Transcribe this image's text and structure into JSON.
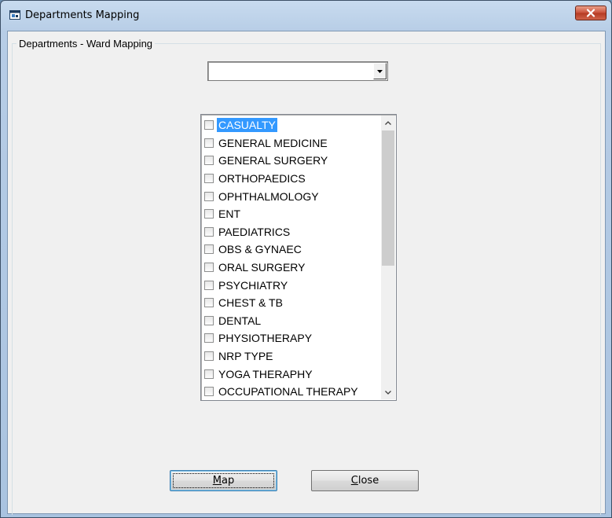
{
  "window": {
    "title": "Departments Mapping",
    "close_glyph": "✕"
  },
  "group": {
    "label": "Departments - Ward Mapping"
  },
  "ward_combo": {
    "value": "",
    "arrow_glyph": "▼"
  },
  "departments": {
    "selected_index": 0,
    "items": [
      {
        "label": "CASUALTY",
        "checked": false
      },
      {
        "label": "GENERAL MEDICINE",
        "checked": false
      },
      {
        "label": "GENERAL SURGERY",
        "checked": false
      },
      {
        "label": "ORTHOPAEDICS",
        "checked": false
      },
      {
        "label": "OPHTHALMOLOGY",
        "checked": false
      },
      {
        "label": "ENT",
        "checked": false
      },
      {
        "label": "PAEDIATRICS",
        "checked": false
      },
      {
        "label": "OBS & GYNAEC",
        "checked": false
      },
      {
        "label": "ORAL SURGERY",
        "checked": false
      },
      {
        "label": "PSYCHIATRY",
        "checked": false
      },
      {
        "label": "CHEST & TB",
        "checked": false
      },
      {
        "label": "DENTAL",
        "checked": false
      },
      {
        "label": "PHYSIOTHERAPY",
        "checked": false
      },
      {
        "label": "NRP TYPE",
        "checked": false
      },
      {
        "label": "YOGA THERAPHY",
        "checked": false
      },
      {
        "label": "OCCUPATIONAL THERAPY",
        "checked": false
      }
    ],
    "scroll_up_glyph": "⌃",
    "scroll_down_glyph": "⌄"
  },
  "buttons": {
    "map": {
      "mnemonic": "M",
      "rest": "ap"
    },
    "close": {
      "mnemonic": "C",
      "rest": "lose"
    }
  },
  "colors": {
    "selection": "#3399ff",
    "close_button": "#c9503a"
  }
}
